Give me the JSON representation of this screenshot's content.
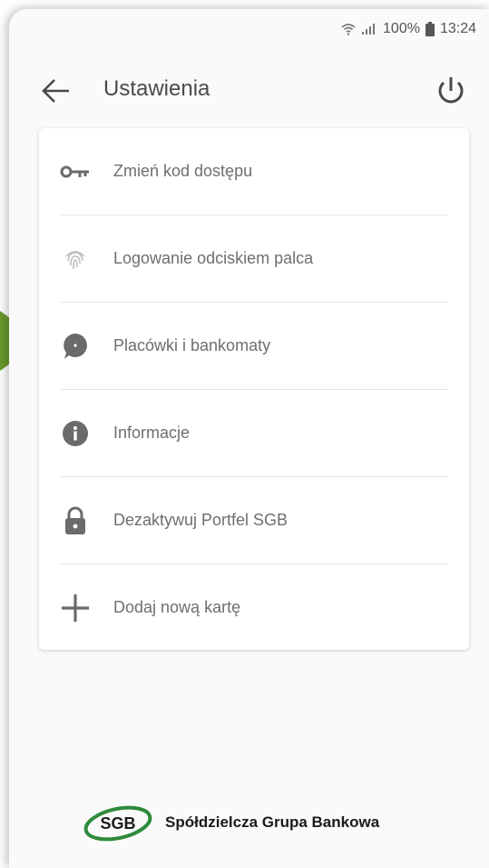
{
  "status_bar": {
    "battery": "100%",
    "time": "13:24",
    "icons": [
      "wifi-icon",
      "signal-icon",
      "battery-icon"
    ]
  },
  "header": {
    "title": "Ustawienia",
    "back_icon": "arrow-left-icon",
    "power_icon": "power-icon"
  },
  "menu": {
    "items": [
      {
        "label": "Zmień kod dostępu",
        "icon": "key-icon"
      },
      {
        "label": "Logowanie odciskiem palca",
        "icon": "fingerprint-icon"
      },
      {
        "label": "Placówki i bankomaty",
        "icon": "location-bubble-icon"
      },
      {
        "label": "Informacje",
        "icon": "info-icon"
      },
      {
        "label": "Dezaktywuj Portfel SGB",
        "icon": "lock-icon"
      },
      {
        "label": "Dodaj nową kartę",
        "icon": "plus-icon"
      }
    ]
  },
  "footer": {
    "logo_text": "SGB",
    "brand": "Spółdzielcza Grupa Bankowa"
  },
  "colors": {
    "accent_arrow": "#6a9a2c",
    "logo_green": "#2f8a3c",
    "icon_gray": "#6b6b6b",
    "text_gray": "#6e6e6e"
  }
}
